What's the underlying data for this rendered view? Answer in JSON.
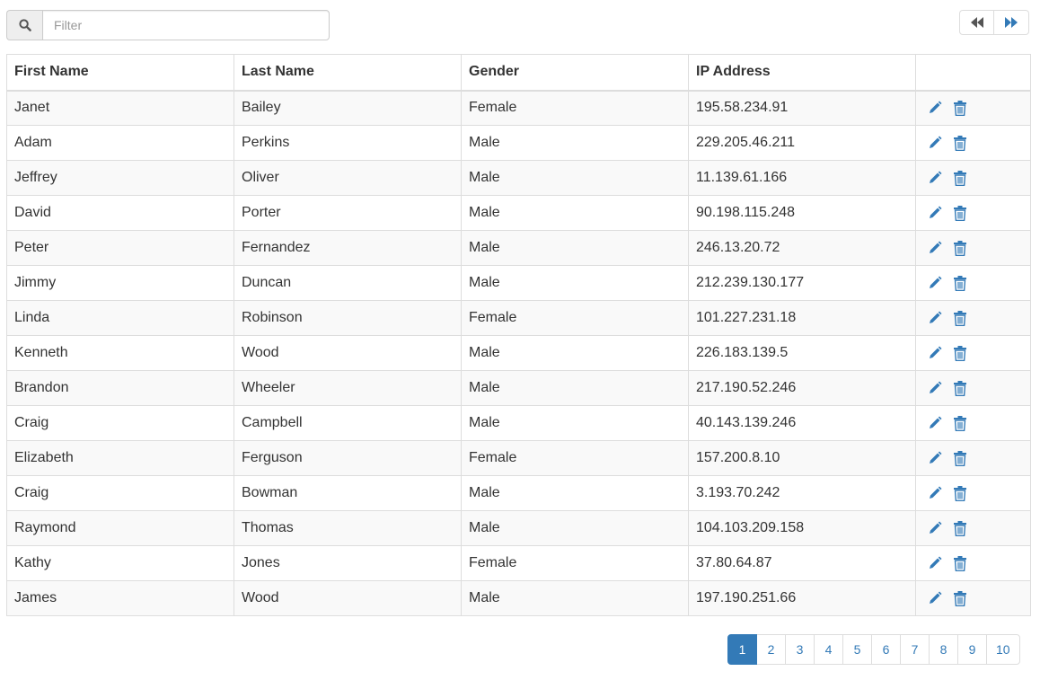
{
  "colors": {
    "accent": "#337ab7",
    "icon_gray": "#555555",
    "border": "#dddddd",
    "stripe": "#f9f9f9"
  },
  "filter": {
    "placeholder": "Filter",
    "value": "",
    "icon": "search-icon"
  },
  "top_pager": {
    "prev_icon": "backward-icon",
    "next_icon": "forward-icon"
  },
  "table": {
    "headers": [
      "First Name",
      "Last Name",
      "Gender",
      "IP Address",
      ""
    ],
    "row_actions": [
      "edit-icon",
      "trash-icon"
    ],
    "rows": [
      {
        "first": "Janet",
        "last": "Bailey",
        "gender": "Female",
        "ip": "195.58.234.91"
      },
      {
        "first": "Adam",
        "last": "Perkins",
        "gender": "Male",
        "ip": "229.205.46.211"
      },
      {
        "first": "Jeffrey",
        "last": "Oliver",
        "gender": "Male",
        "ip": "11.139.61.166"
      },
      {
        "first": "David",
        "last": "Porter",
        "gender": "Male",
        "ip": "90.198.115.248"
      },
      {
        "first": "Peter",
        "last": "Fernandez",
        "gender": "Male",
        "ip": "246.13.20.72"
      },
      {
        "first": "Jimmy",
        "last": "Duncan",
        "gender": "Male",
        "ip": "212.239.130.177"
      },
      {
        "first": "Linda",
        "last": "Robinson",
        "gender": "Female",
        "ip": "101.227.231.18"
      },
      {
        "first": "Kenneth",
        "last": "Wood",
        "gender": "Male",
        "ip": "226.183.139.5"
      },
      {
        "first": "Brandon",
        "last": "Wheeler",
        "gender": "Male",
        "ip": "217.190.52.246"
      },
      {
        "first": "Craig",
        "last": "Campbell",
        "gender": "Male",
        "ip": "40.143.139.246"
      },
      {
        "first": "Elizabeth",
        "last": "Ferguson",
        "gender": "Female",
        "ip": "157.200.8.10"
      },
      {
        "first": "Craig",
        "last": "Bowman",
        "gender": "Male",
        "ip": "3.193.70.242"
      },
      {
        "first": "Raymond",
        "last": "Thomas",
        "gender": "Male",
        "ip": "104.103.209.158"
      },
      {
        "first": "Kathy",
        "last": "Jones",
        "gender": "Female",
        "ip": "37.80.64.87"
      },
      {
        "first": "James",
        "last": "Wood",
        "gender": "Male",
        "ip": "197.190.251.66"
      }
    ]
  },
  "pagination": {
    "pages": [
      "1",
      "2",
      "3",
      "4",
      "5",
      "6",
      "7",
      "8",
      "9",
      "10"
    ],
    "active": "1"
  }
}
